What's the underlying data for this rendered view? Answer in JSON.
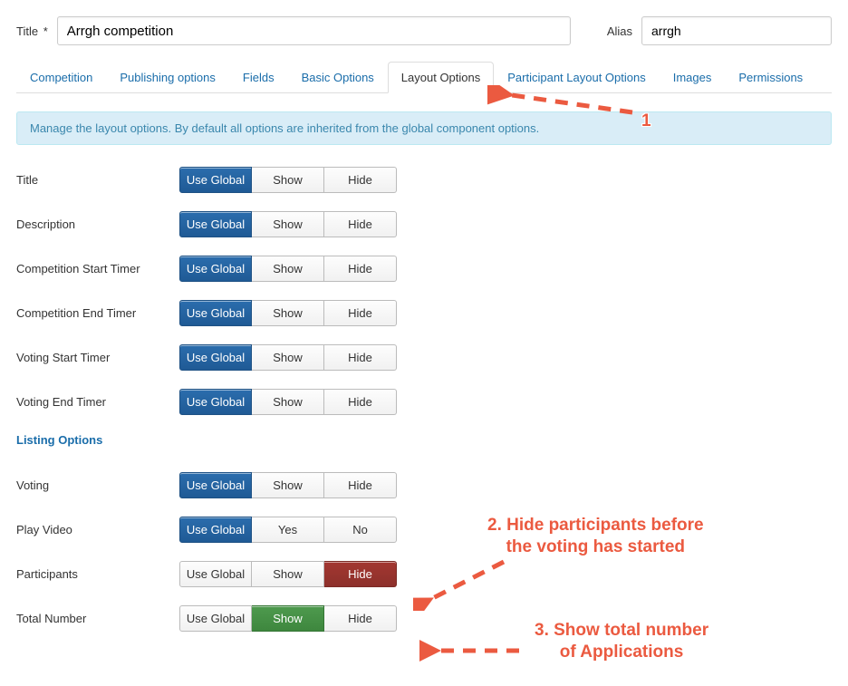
{
  "titleRow": {
    "label": "Title",
    "required_mark": "*",
    "value": "Arrgh competition",
    "aliasLabel": "Alias",
    "aliasValue": "arrgh"
  },
  "tabs": [
    "Competition",
    "Publishing options",
    "Fields",
    "Basic Options",
    "Layout Options",
    "Participant Layout Options",
    "Images",
    "Permissions"
  ],
  "activeTabIndex": 4,
  "notice": "Manage the layout options. By default all options are inherited from the global component options.",
  "buttonLabels": {
    "useGlobal": "Use Global",
    "show": "Show",
    "hide": "Hide",
    "yes": "Yes",
    "no": "No"
  },
  "sections": [
    {
      "heading": null,
      "rows": [
        {
          "name": "title",
          "label": "Title",
          "kind": "showhide",
          "selected": 0
        },
        {
          "name": "description",
          "label": "Description",
          "kind": "showhide",
          "selected": 0
        },
        {
          "name": "comp-start",
          "label": "Competition Start Timer",
          "kind": "showhide",
          "selected": 0
        },
        {
          "name": "comp-end",
          "label": "Competition End Timer",
          "kind": "showhide",
          "selected": 0
        },
        {
          "name": "vote-start",
          "label": "Voting Start Timer",
          "kind": "showhide",
          "selected": 0
        },
        {
          "name": "vote-end",
          "label": "Voting End Timer",
          "kind": "showhide",
          "selected": 0
        }
      ]
    },
    {
      "heading": "Listing Options",
      "rows": [
        {
          "name": "voting",
          "label": "Voting",
          "kind": "showhide",
          "selected": 0
        },
        {
          "name": "play-video",
          "label": "Play Video",
          "kind": "yesno",
          "selected": 0
        },
        {
          "name": "participants",
          "label": "Participants",
          "kind": "showhide",
          "selected": 2
        },
        {
          "name": "total-number",
          "label": "Total Number",
          "kind": "showhide",
          "selected": 1
        }
      ]
    }
  ],
  "annotations": {
    "a1_num": "1",
    "a2_text": "2. Hide participants before\nthe voting has started",
    "a3_text": "3. Show total number\nof Applications"
  },
  "colors": {
    "annotation": "#eb5a40",
    "blue": "#1f5a95",
    "green": "#3e873e",
    "red": "#8d302b"
  }
}
